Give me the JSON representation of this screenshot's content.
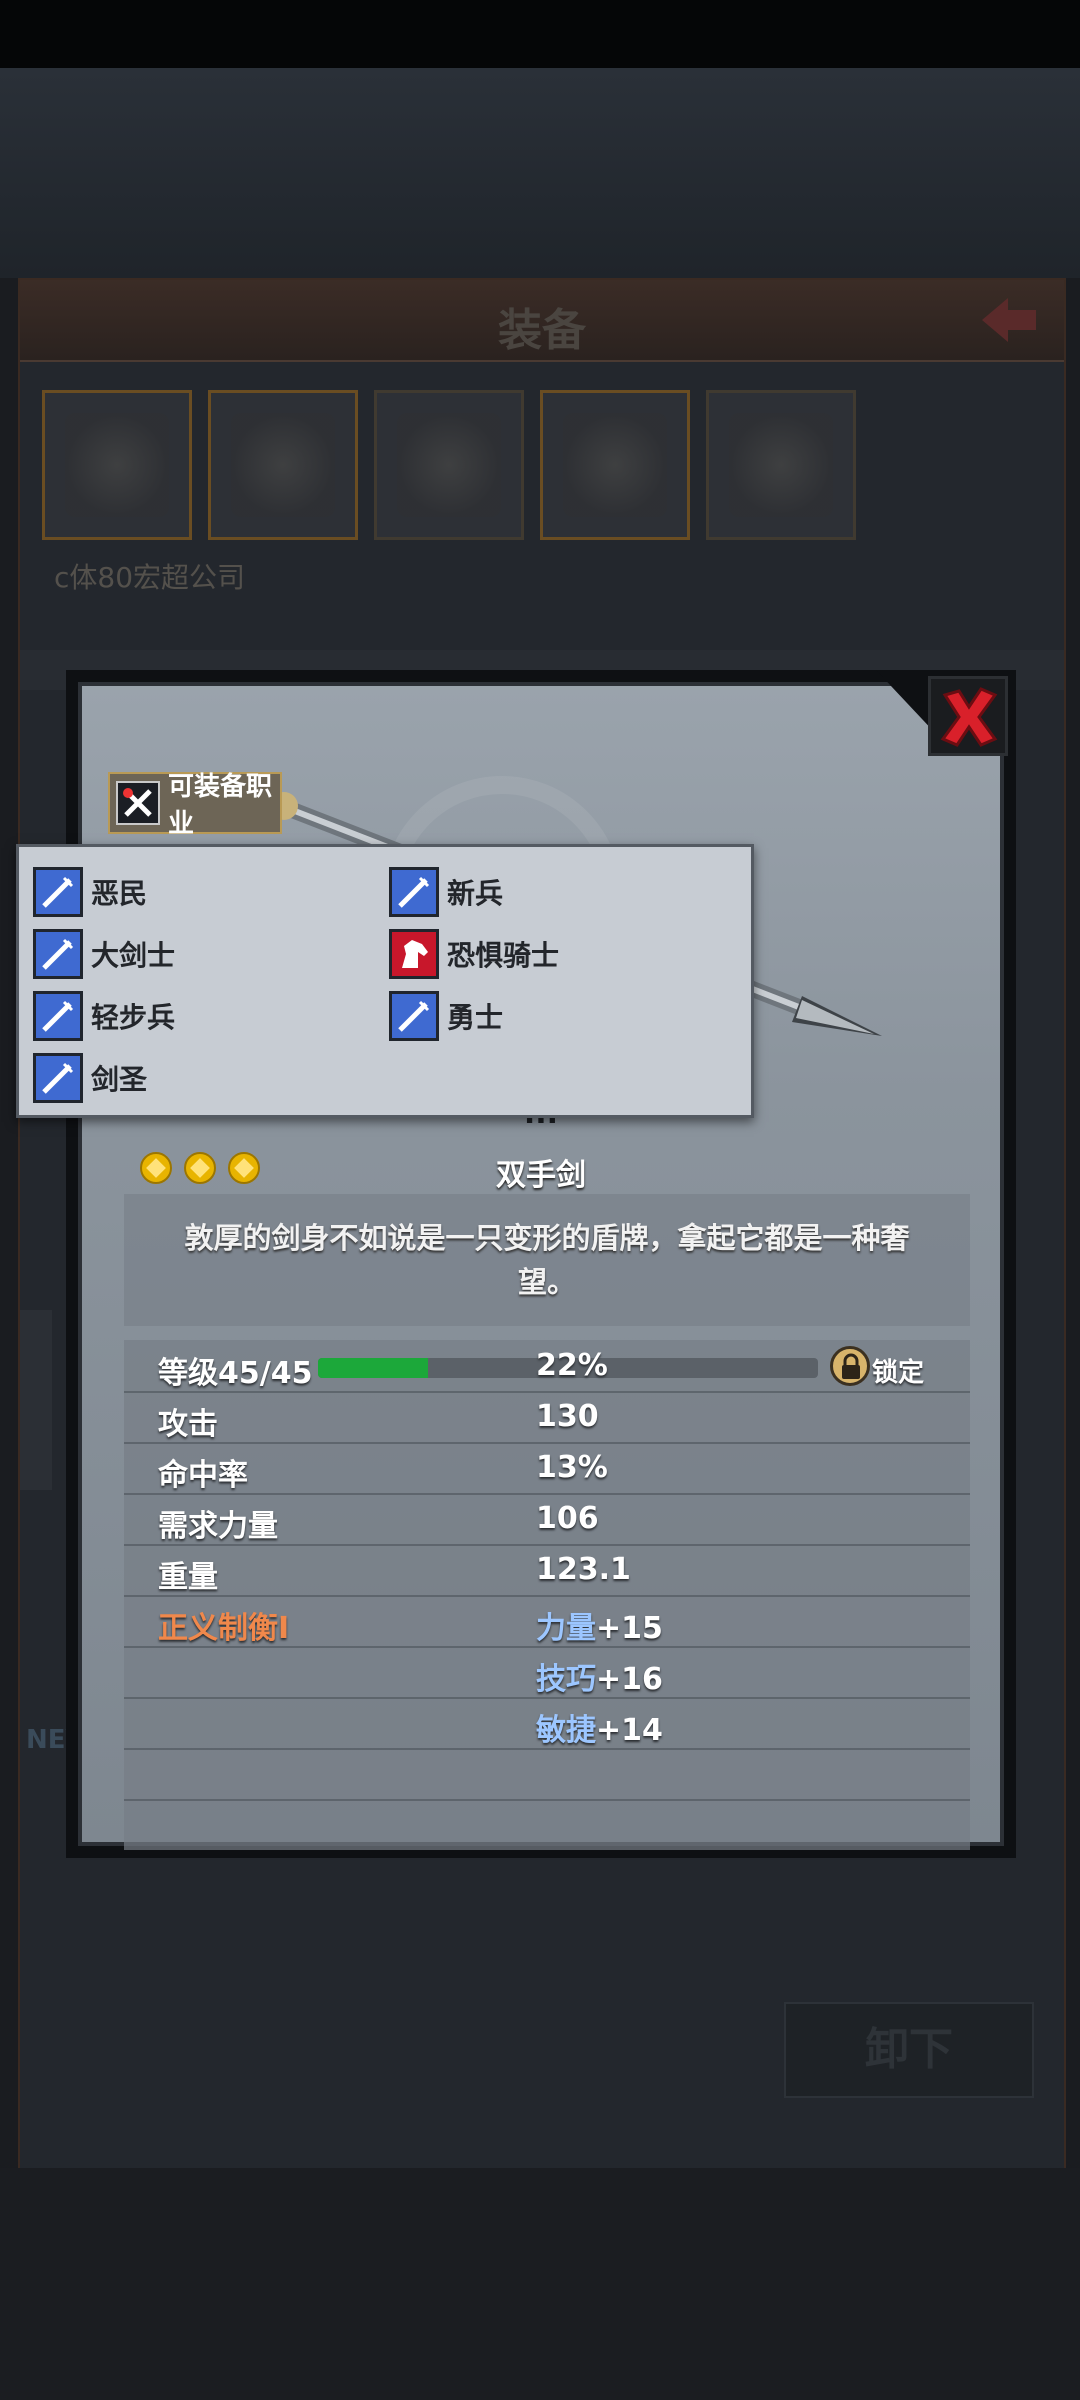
{
  "underlying_screen": {
    "title": "装备",
    "note": "c体80宏超公司",
    "new_label": "NEV",
    "unequip_label": "卸下"
  },
  "detail": {
    "class_button_label": "可装备职业",
    "item_name_partial": "...",
    "item_type": "双手剑",
    "stars": 3,
    "description": "敦厚的剑身不如说是一只变形的盾牌，拿起它都是一种奢望。",
    "level_label": "等级45/45",
    "level_progress_text": "22%",
    "level_progress": 0.22,
    "lock_label": "锁定",
    "stats": [
      {
        "name": "攻击",
        "value": "130"
      },
      {
        "name": "命中率",
        "value": "13%"
      },
      {
        "name": "需求力量",
        "value": "106"
      },
      {
        "name": "重量",
        "value": "123.1"
      }
    ],
    "set_bonus": {
      "name": "正义制衡I",
      "bonuses": [
        {
          "attr": "力量",
          "value": "+15"
        },
        {
          "attr": "技巧",
          "value": "+16"
        },
        {
          "attr": "敏捷",
          "value": "+14"
        }
      ]
    }
  },
  "class_popup": {
    "classes": [
      {
        "name": "恶民",
        "icon": "sword-icon"
      },
      {
        "name": "新兵",
        "icon": "sword-icon"
      },
      {
        "name": "大剑士",
        "icon": "sword-icon"
      },
      {
        "name": "恐惧骑士",
        "icon": "horse-icon"
      },
      {
        "name": "轻步兵",
        "icon": "sword-icon"
      },
      {
        "name": "勇士",
        "icon": "sword-icon"
      },
      {
        "name": "剑圣",
        "icon": "sword-icon"
      }
    ]
  },
  "colors": {
    "popup_bg": "#c7ccd3",
    "class_icon_blue": "#3f6ad1",
    "class_icon_red": "#c8172b",
    "set_bonus_name": "#f0884b",
    "set_bonus_attr": "#9cc6ff",
    "level_fill": "#1ca83a"
  }
}
